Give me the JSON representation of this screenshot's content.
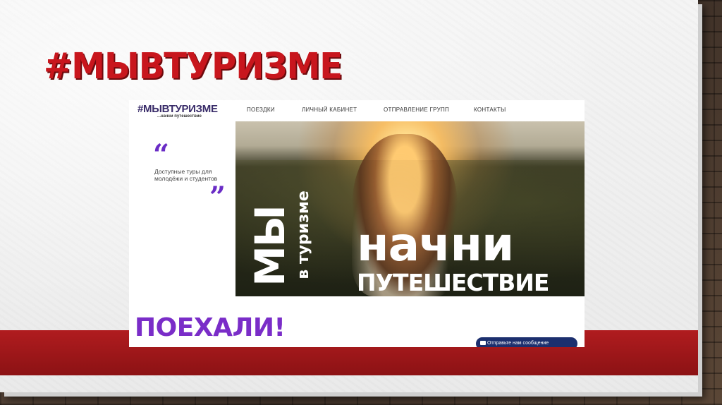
{
  "slide": {
    "title": "#МЫВТУРИЗМЕ"
  },
  "website": {
    "logo": "#МЫВТУРИЗМЕ",
    "logo_tagline": "...начни путешествие",
    "nav": [
      {
        "label": "ПОЕЗДКИ"
      },
      {
        "label": "ЛИЧНЫЙ КАБИНЕТ"
      },
      {
        "label": "ОТПРАВЛЕНИЕ ГРУПП"
      },
      {
        "label": "КОНТАКТЫ"
      }
    ],
    "quote_open": "“",
    "quote_text": "Доступные туры для молодёжи и студентов",
    "quote_close": "”",
    "hero_vertical_big": "МЫ",
    "hero_vertical_small": "в туризме",
    "hero_word1": "начни",
    "hero_word2": "ПУТЕШЕСТВИЕ",
    "cta": "ПОЕХАЛИ!",
    "chat_button": "Отправьте нам сообщение"
  },
  "colors": {
    "title_red": "#c8161d",
    "band_red": "#b01c1f",
    "accent_purple": "#7a2dc8",
    "chat_navy": "#1c2f6e"
  }
}
